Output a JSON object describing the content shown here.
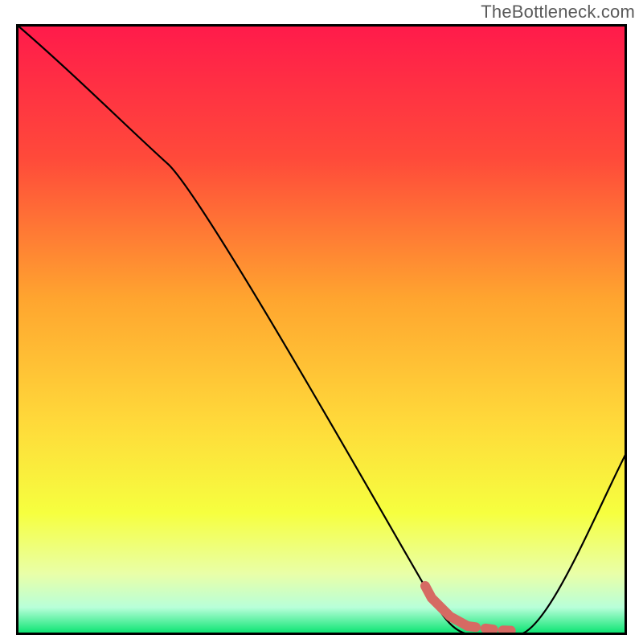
{
  "watermark": "TheBottleneck.com",
  "chart_data": {
    "type": "line",
    "title": "",
    "xlabel": "",
    "ylabel": "",
    "ylim": [
      0,
      100
    ],
    "xlim": [
      0,
      100
    ],
    "series": [
      {
        "name": "bottleneck-curve",
        "x": [
          0,
          25,
          68,
          75,
          82,
          100
        ],
        "values": [
          100,
          77,
          6,
          0,
          0,
          30
        ]
      }
    ],
    "highlight_segment": {
      "name": "optimal-zone-marker",
      "x": [
        67,
        68,
        71,
        74,
        77,
        79,
        82
      ],
      "values": [
        8,
        6,
        3,
        1.5,
        1,
        0.8,
        0.7
      ]
    },
    "gradient_stops": [
      {
        "offset": 0.0,
        "color": "#ff1a4b"
      },
      {
        "offset": 0.22,
        "color": "#ff4a3a"
      },
      {
        "offset": 0.45,
        "color": "#ffa52f"
      },
      {
        "offset": 0.65,
        "color": "#ffd93a"
      },
      {
        "offset": 0.8,
        "color": "#f6ff3f"
      },
      {
        "offset": 0.9,
        "color": "#e9ffa8"
      },
      {
        "offset": 0.955,
        "color": "#b8ffd9"
      },
      {
        "offset": 1.0,
        "color": "#00e26b"
      }
    ],
    "colors": {
      "curve": "#000000",
      "highlight": "#d66a63",
      "frame": "#000000",
      "background_outside": "#ffffff"
    }
  }
}
